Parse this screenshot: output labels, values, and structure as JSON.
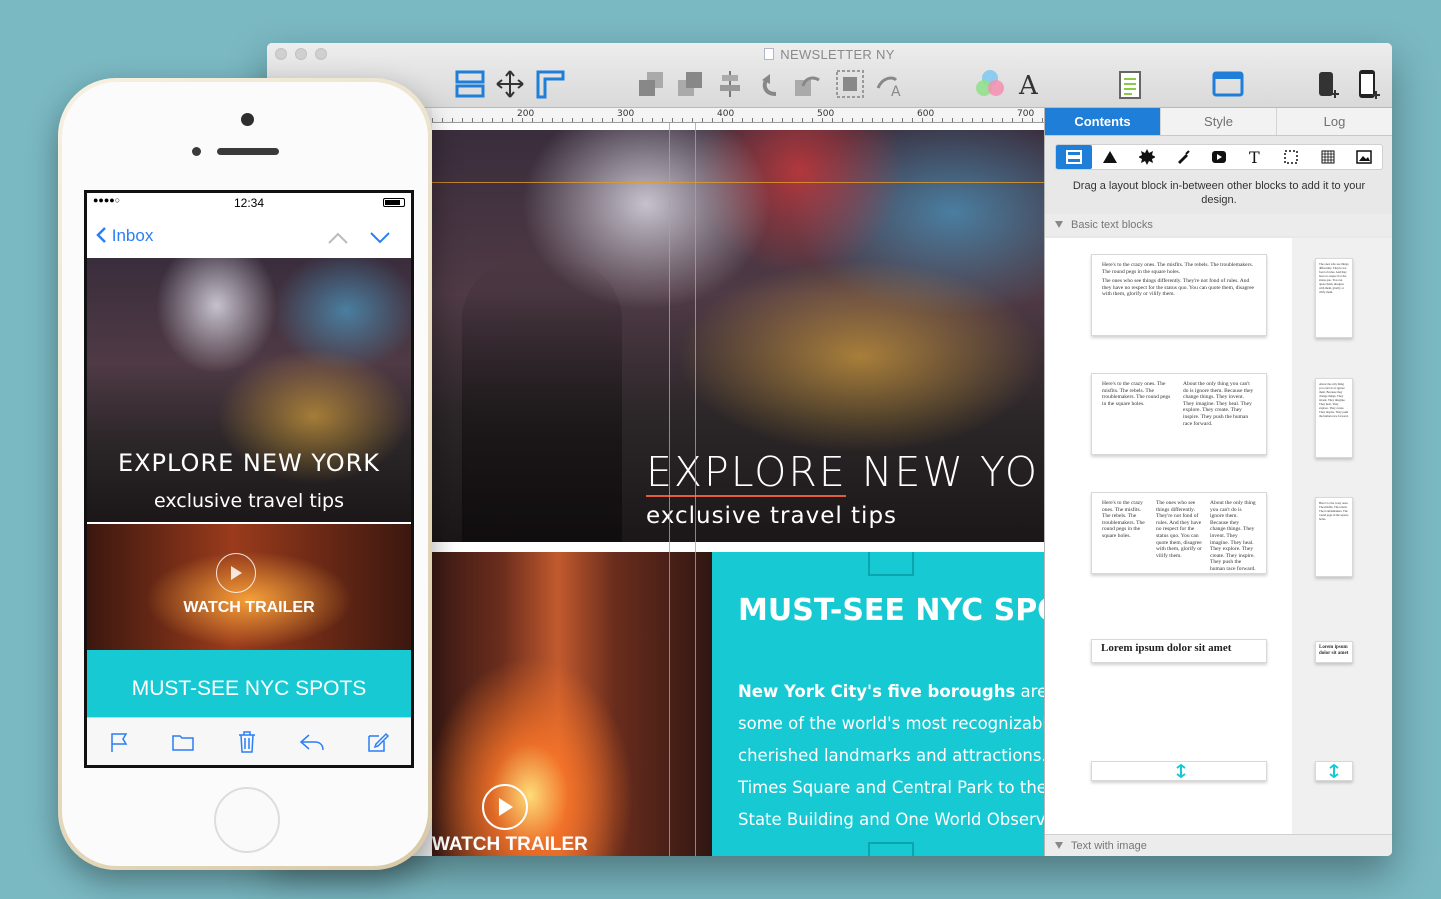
{
  "window": {
    "title": "NEWSLETTER NY"
  },
  "toolbar_icons": [
    "layout-icon",
    "move-icon",
    "ruler-icon",
    "send-backward-icon",
    "bring-forward-icon",
    "align-icon",
    "undo-icon",
    "redo-icon",
    "group-icon",
    "text-flow-icon",
    "colors-icon",
    "fonts-icon",
    "checklist-icon",
    "preview-icon",
    "phone-add-icon",
    "device-icon"
  ],
  "ruler": {
    "marks": [
      "200",
      "300",
      "400",
      "500",
      "600",
      "700"
    ]
  },
  "canvas": {
    "hero_title": "EXPLORE NEW YORK",
    "hero_subtitle": "exclusive travel tips",
    "trailer_label": "WATCH TRAILER",
    "spots_title": "MUST-SEE NYC SPOTS",
    "spots_lead": "New York City's five boroughs",
    "spots_line1": " are home to",
    "spots_line2": "some of the world's most recognizable,",
    "spots_line3": "cherished landmarks and attractions. From",
    "spots_line4": "Times Square and Central Park to the Empire",
    "spots_line5": "State Building and One World Observatory"
  },
  "panel": {
    "tabs": [
      "Contents",
      "Style",
      "Log"
    ],
    "active_tab": "Contents",
    "hint": "Drag a layout block in-between other blocks to add it to your design.",
    "section_basic": "Basic text blocks",
    "section_image": "Text with image",
    "sample_text_a": "Here's to the crazy ones. The misfits. The rebels. The troublemakers. The round pegs in the square holes.",
    "sample_text_b": "The ones who see things differently. They're not fond of rules. And they have no respect for the status quo. You can quote them, disagree with them, glorify or vilify them.",
    "sample_text_c": "About the only thing you can't do is ignore them. Because they change things. They invent. They imagine. They heal. They explore. They create. They inspire. They push the human race forward.",
    "heading_sample": "Lorem ipsum dolor sit amet",
    "heading_sample_small": "Lorem ipsum dolor sit amet",
    "accent": "#1e7ed8"
  },
  "phone": {
    "status_time": "12:34",
    "signal": "●●●●○",
    "back_label": "Inbox",
    "hero_title": "EXPLORE NEW YORK",
    "hero_subtitle": "exclusive travel tips",
    "trailer_label": "WATCH TRAILER",
    "spots_label": "MUST-SEE NYC SPOTS"
  },
  "colors": {
    "teal": "#17c9d3",
    "accent_blue": "#1e7ed8",
    "guide_orange": "#e49b2b"
  }
}
